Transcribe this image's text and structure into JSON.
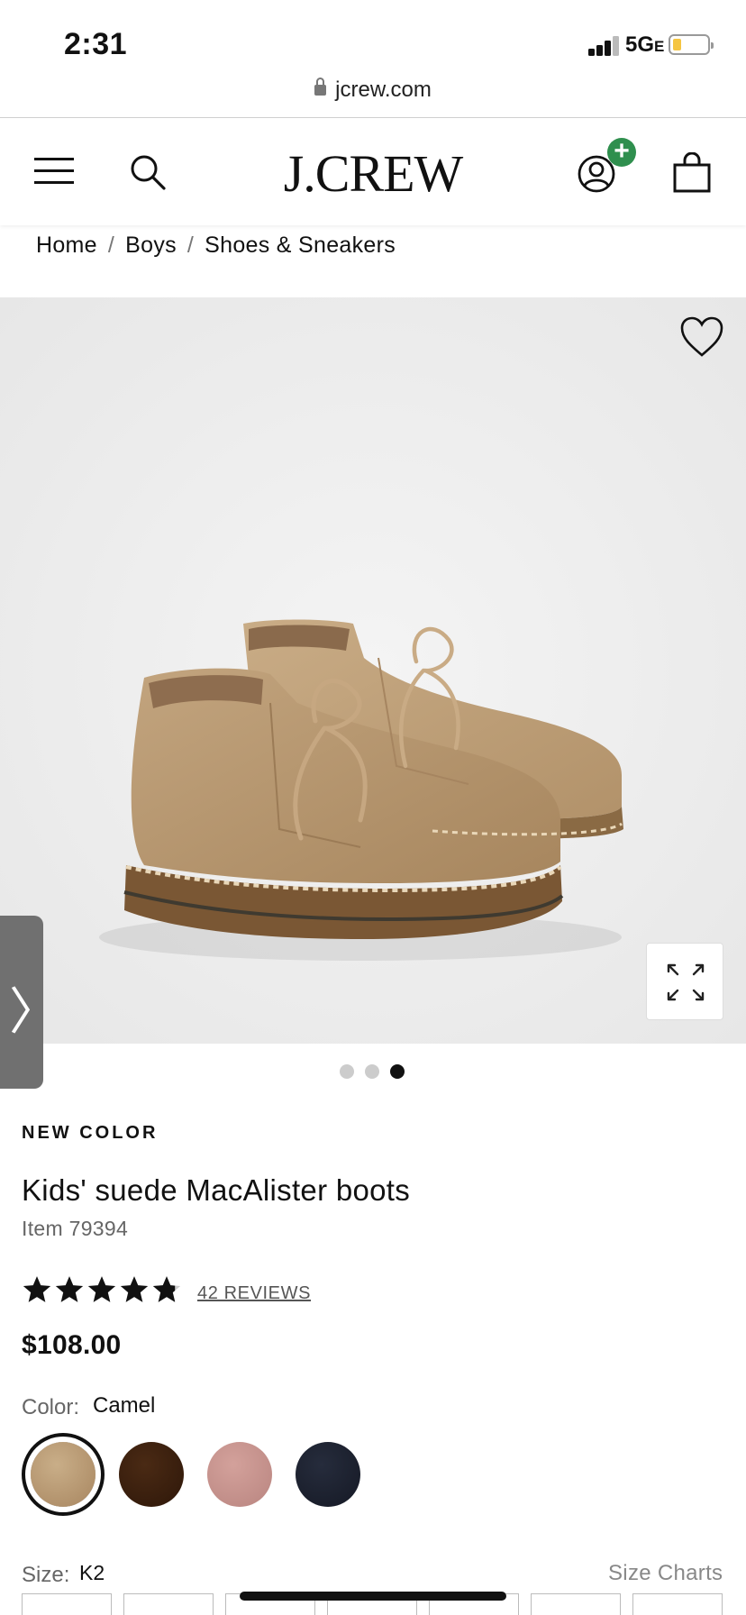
{
  "status_bar": {
    "time": "2:31",
    "network": "5G",
    "network_suffix": "E",
    "url": "jcrew.com"
  },
  "header": {
    "logo": "J.CREW",
    "menu_icon": "hamburger-menu-icon",
    "search_icon": "search-icon",
    "account_icon": "account-icon",
    "account_badge": "+",
    "bag_icon": "shopping-bag-icon",
    "badge_color": "#2f8f4e"
  },
  "breadcrumb": {
    "items": [
      "Home",
      "Boys",
      "Shoes & Sneakers"
    ],
    "separator": "/"
  },
  "gallery": {
    "image_alt": "Kids' suede MacAlister boots in camel",
    "favorite_icon": "heart-icon",
    "expand_icon": "expand-icon",
    "side_tab_glyph": "〉",
    "dot_count": 3,
    "active_dot": 3
  },
  "product": {
    "badge": "NEW COLOR",
    "title": "Kids' suede MacAlister boots",
    "item": "Item 79394",
    "rating": 4.8,
    "reviews_label": "42 REVIEWS",
    "price": "$108.00",
    "color_label": "Color:",
    "color_value": "Camel",
    "swatches": [
      {
        "name": "camel",
        "color": "#b99a73",
        "selected": true
      },
      {
        "name": "dark-brown",
        "color": "#3a2010",
        "selected": false
      },
      {
        "name": "dusty-pink",
        "color": "#c99590",
        "selected": false
      },
      {
        "name": "navy",
        "color": "#1d2230",
        "selected": false
      }
    ],
    "size_label": "Size:",
    "size_value": "K2",
    "size_charts": "Size Charts"
  }
}
